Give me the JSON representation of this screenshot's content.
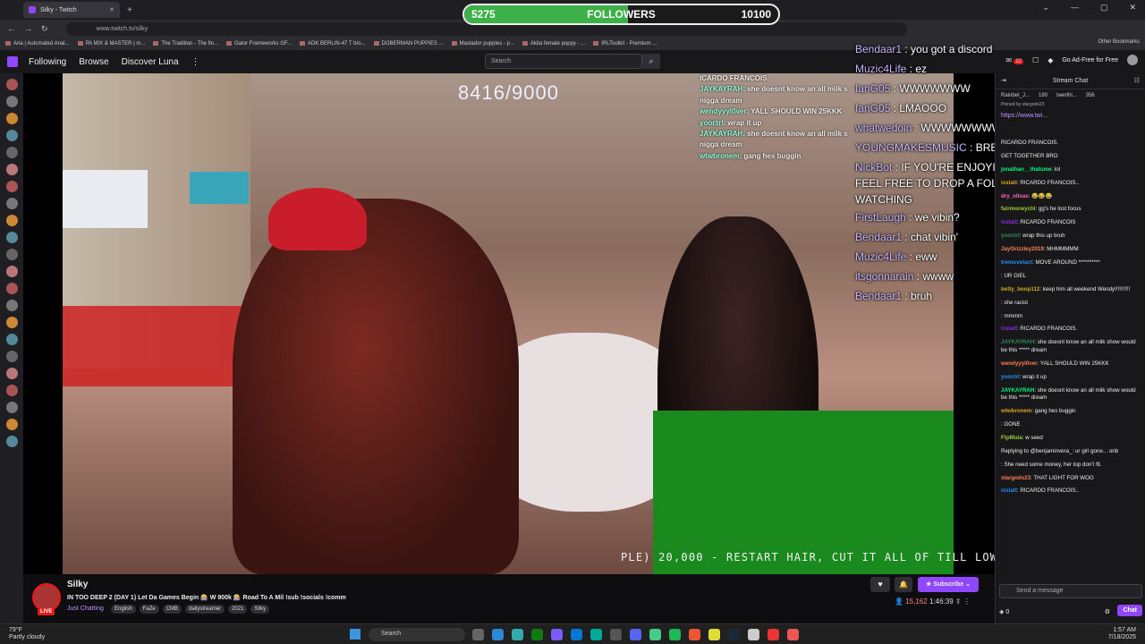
{
  "browser": {
    "tab_title": "Silky - Twitch",
    "url": "www.twitch.tv/silky",
    "bookmarks": [
      "Aria | Automated Anal...",
      "PA MIX & MASTER | m...",
      "The Tradition - The fin...",
      "Gator Frameworks GF...",
      "ADK BERLIN-47 T b/o...",
      "DOBERMAN PUPPIES ...",
      "Mastador puppies - p...",
      "Akita female puppy - ...",
      "IRLToolkit - Premium ..."
    ],
    "other_bookmarks": "Other Bookmarks"
  },
  "followers_goal": {
    "current": "5275",
    "title": "FOLLOWERS",
    "target": "10100",
    "progress": 0.52
  },
  "topnav": {
    "following": "Following",
    "browse": "Browse",
    "discover": "Discover Luna",
    "more": "⋮",
    "search_placeholder": "Search",
    "notif_count": "22",
    "adfree": "Go Ad-Free for Free"
  },
  "video": {
    "counter": "8416/9000",
    "ticker": "PLE) 20,000 - RESTART HAIR, CUT IT ALL OF TILL LOW C",
    "chat": [
      {
        "user": "",
        "text": "ICARDO FRANCOIS."
      },
      {
        "user": "JAYKAYRAH",
        "text": ": she doesnt know an all milk s"
      },
      {
        "user": "",
        "text": "nigga dream"
      },
      {
        "user": "wendyyyl0ver",
        "text": ": YALL SHOULD WIN 25KKK"
      },
      {
        "user": "yooctrl",
        "text": ": wrap it up"
      },
      {
        "user": "JAYKAYRAH",
        "text": ": she doesnt know an all milk s"
      },
      {
        "user": "",
        "text": "nigga dream"
      },
      {
        "user": "wtwbronem",
        "text": ": gang hes buggin"
      }
    ]
  },
  "overlay_chat": [
    {
      "user": "Bendaar1",
      "text": " : you got a discord"
    },
    {
      "user": "Muzic4Life",
      "text": " : ez"
    },
    {
      "user": "IanG05",
      "text": " : WWWWWWW"
    },
    {
      "user": "IanG05",
      "text": " : LMAOOO"
    },
    {
      "user": "whatwedoin",
      "text": " : WWWWWWWWWWWWWW"
    },
    {
      "user": "YOUNGMAKESMUSIC",
      "text": " : BRB"
    },
    {
      "user": "NickBot",
      "text": " : IF YOU'RE ENJOYING THE STREAM, FEEL FREE TO DROP A FOLLOW. THANKS FOR WATCHING"
    },
    {
      "user": "FirstLaugh",
      "text": " : we vibin?"
    },
    {
      "user": "Bendaar1",
      "text": " : chat vibin'"
    },
    {
      "user": "Muzic4Life",
      "text": " : eww"
    },
    {
      "user": "itsgonnarain",
      "text": " : wwww"
    },
    {
      "user": "Bendaar1",
      "text": " : bruh"
    }
  ],
  "stream": {
    "name": "Silky",
    "live": "LIVE",
    "title": "IN TOO DEEP 2 (DAY 1) Let Da Games Begin 🎰 W 900k 🎰 Road To A Mil !sub !socials !comm",
    "category": "Just Chatting",
    "tags": [
      "English",
      "FaZe",
      "CMB",
      "dailystreamer",
      "2021",
      "Silky"
    ],
    "subscribe": "Subscribe",
    "viewers": "15,162",
    "uptime": "1:46:39"
  },
  "chat": {
    "title": "Stream Chat",
    "hype": [
      "Rainbet_J...",
      "180",
      "Iwerthl...",
      "356"
    ],
    "pinned_by": "Pinned by stargods23",
    "pinned_link": "https://www.twi...",
    "messages": [
      {
        "user": "",
        "text": "RICARDO FRANCOIS."
      },
      {
        "user": "",
        "text": "GET TOGETHER BRO"
      },
      {
        "user": "jonathan__thatsme",
        "text": ": lol"
      },
      {
        "user": "ixslatt",
        "text": ": RICARDO FRANCOIS.."
      },
      {
        "user": "dry_olivas",
        "text": ": 😂😂😂"
      },
      {
        "user": "fairmoneychi",
        "text": ": gg's he lost focus"
      },
      {
        "user": "ixslatt",
        "text": ": RICARDO FRANCOIS"
      },
      {
        "user": "yooctrl",
        "text": ": wrap this up bruh"
      },
      {
        "user": "JayGrizzley2019",
        "text": ": MHMMMMM"
      },
      {
        "user": "tremovetact",
        "text": ": MOVE AROUND **********"
      },
      {
        "user": "",
        "text": ": UR GIEL"
      },
      {
        "user": "betty_boop112",
        "text": ": keep him all weekend Wendy!!!!!!!!!!"
      },
      {
        "user": "",
        "text": ": she racist"
      },
      {
        "user": "",
        "text": ": mmmm"
      },
      {
        "user": "ixslatt",
        "text": ": RICARDO FRANCOIS."
      },
      {
        "user": "JAYKAYRAH",
        "text": ": she doesnt know an all milk show would be this ***** dream"
      },
      {
        "user": "wendyyyl0ver",
        "text": ": YALL SHOULD WIN 25KKK"
      },
      {
        "user": "yooctrl",
        "text": ": wrap it up"
      },
      {
        "user": "JAYKAYRAH",
        "text": ": she doesnt know an all milk show would be this ***** dream"
      },
      {
        "user": "wtwbronem",
        "text": ": gang hes buggin"
      },
      {
        "user": "",
        "text": ": GONE"
      },
      {
        "user": "FtpMula",
        "text": ": w seed"
      },
      {
        "user": "",
        "text": "Replying to @benjaminvera_: ur girl gone... onb"
      },
      {
        "user": "",
        "text": ": She need some money, her top don't fit."
      },
      {
        "user": "stargods23",
        "text": ": THAT LIGHT FOR WOO"
      },
      {
        "user": "ixslatt",
        "text": ": RICARDO FRANCOIS.."
      }
    ],
    "input_placeholder": "Send a message",
    "points": "0",
    "send": "Chat"
  },
  "taskbar": {
    "weather_temp": "79°F",
    "weather_desc": "Partly cloudy",
    "search": "Search",
    "time": "1:57 AM",
    "date": "7/18/2025"
  },
  "colors": {
    "accent": "#9146ff",
    "goal_fill": "#3db04a",
    "live": "#e91916"
  }
}
